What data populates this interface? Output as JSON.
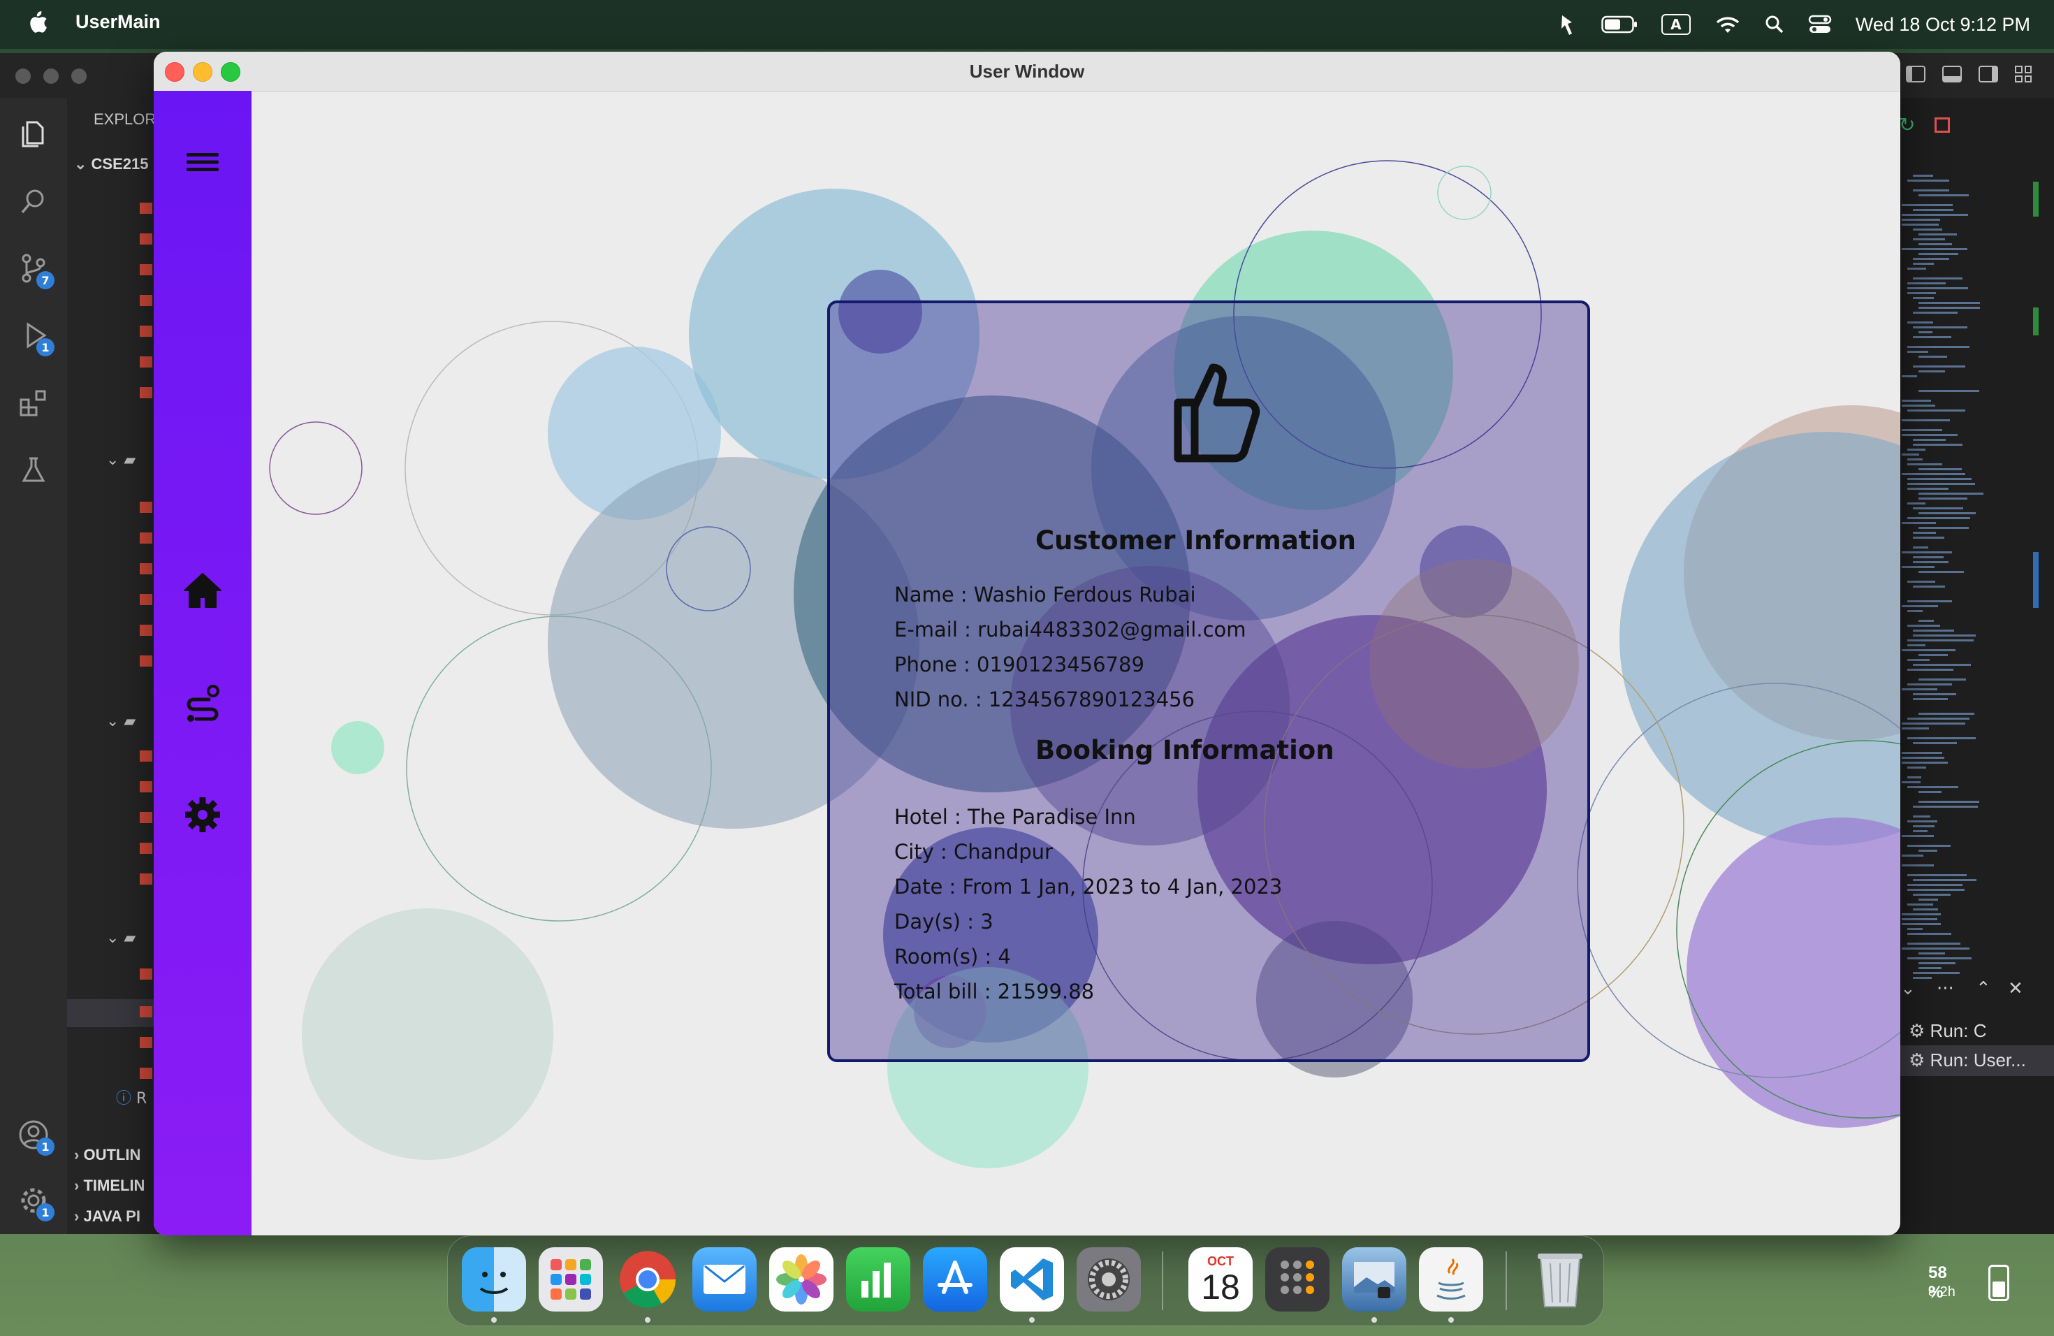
{
  "menubar": {
    "app_name": "UserMain",
    "clock": "Wed 18 Oct  9:12 PM",
    "icons": [
      "apple-icon",
      "hotspot-icon",
      "battery-icon",
      "input-source-icon",
      "wifi-icon",
      "spotlight-icon",
      "control-center-icon"
    ],
    "input_source": "A"
  },
  "vscode": {
    "explorer_title": "EXPLOR",
    "project": "CSE215",
    "sections": [
      "OUTLIN",
      "TIMELIN",
      "JAVA PI"
    ],
    "info_item": "R",
    "badges": {
      "source_control": "7",
      "run_debug": "1",
      "account": "1",
      "settings": "1"
    },
    "run_items": [
      "Run: C",
      "Run: User..."
    ]
  },
  "window": {
    "title": "User Window",
    "sidebar": {
      "items": [
        "menu-icon",
        "home-icon",
        "route-icon",
        "settings-icon"
      ]
    },
    "card": {
      "icon": "thumbs-up-icon",
      "customer_heading": "Customer Information",
      "customer": {
        "name": "Name : Washio Ferdous Rubai",
        "email": "E-mail : rubai4483302@gmail.com",
        "phone": "Phone : 0190123456789",
        "nid": "NID no. : 1234567890123456"
      },
      "booking_heading": "Booking Information",
      "booking": {
        "hotel": "Hotel : The Paradise Inn",
        "city": "City : Chandpur",
        "date": "Date : From 1 Jan, 2023 to 4 Jan, 2023",
        "days": "Day(s) : 3",
        "rooms": "Room(s) : 4",
        "bill": "Total bill : 21599.88"
      }
    },
    "colors": {
      "sidebar_top": "#6a16f4",
      "sidebar_bottom": "#8b1cf5",
      "card_border": "#141a6b"
    }
  },
  "dock": {
    "apps": [
      "finder-icon",
      "launchpad-icon",
      "chrome-icon",
      "mail-icon",
      "photos-icon",
      "numbers-icon",
      "app-store-icon",
      "vscode-icon",
      "system-settings-icon",
      "calendar-icon",
      "calculator-icon",
      "preview-icon",
      "java-icon",
      "trash-icon"
    ],
    "calendar_month": "OCT",
    "calendar_day": "18",
    "battery_percent": "58 %",
    "battery_time": "8.2h"
  }
}
